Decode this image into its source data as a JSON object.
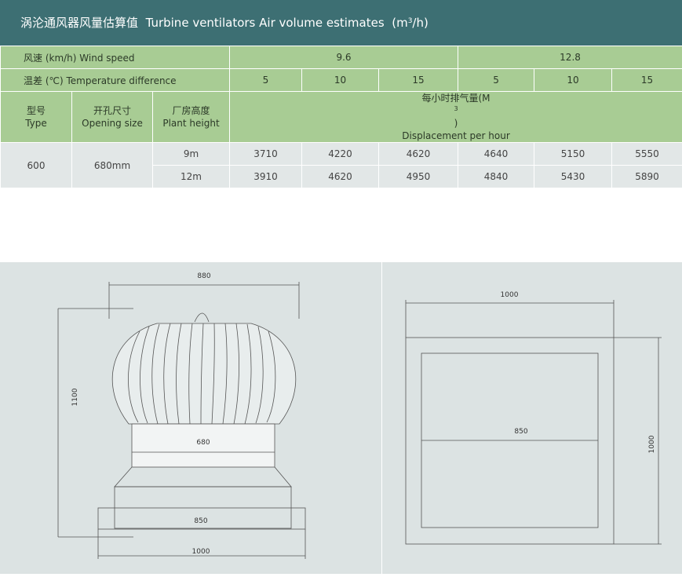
{
  "title": {
    "cn": "涡沦通风器风量估算值",
    "en": "Turbine ventilators Air volume estimates",
    "unit_prefix": "(m",
    "unit_sup": "3",
    "unit_suffix": "/h)"
  },
  "table": {
    "wind_speed_label": "风速 (km/h)  Wind speed",
    "wind_speeds": [
      "9.6",
      "12.8"
    ],
    "temp_label": "温差 (℃)  Temperature difference",
    "temps": [
      "5",
      "10",
      "15",
      "5",
      "10",
      "15"
    ],
    "col_type_cn": "型号",
    "col_type_en": "Type",
    "col_opening_cn": "开孔尺寸",
    "col_opening_en": "Opening size",
    "col_height_cn": "厂房高度",
    "col_height_en": "Plant height",
    "col_disp_cn": "每小时排气量(M",
    "col_disp_sup": "3",
    "col_disp_cn_end": ")",
    "col_disp_en": "Displacement per hour",
    "type_value": "600",
    "opening_value": "680mm",
    "rows": [
      {
        "height": "9m",
        "values": [
          "3710",
          "4220",
          "4620",
          "4640",
          "5150",
          "5550"
        ]
      },
      {
        "height": "12m",
        "values": [
          "3910",
          "4620",
          "4950",
          "4840",
          "5430",
          "5890"
        ]
      }
    ]
  },
  "drawings": {
    "left": {
      "dim_top": "880",
      "dim_height": "1100",
      "dim_neck": "680",
      "dim_base_inner": "850",
      "dim_base_outer": "1000"
    },
    "right": {
      "dim_top": "1000",
      "dim_inner": "850",
      "dim_side": "1000"
    }
  },
  "colors": {
    "header_bg": "#3d6f73",
    "table_green": "#a8cc94",
    "table_grey": "#e2e7e7",
    "panel_bg": "#dce3e3"
  }
}
